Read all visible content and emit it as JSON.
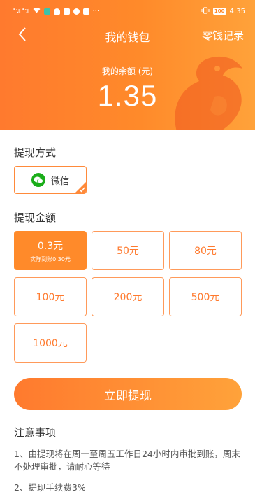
{
  "status_bar": {
    "signal_left": "⁴ᴳ.ıl ⁴ᴳ.ıl",
    "battery": "100",
    "time": "4:35"
  },
  "header": {
    "title": "我的钱包",
    "right_link": "零钱记录",
    "balance_label": "我的余额 (元)",
    "balance_value": "1.35"
  },
  "withdraw_method": {
    "title": "提现方式",
    "option": {
      "label": "微信",
      "icon": "wechat-icon",
      "selected": true
    }
  },
  "withdraw_amount": {
    "title": "提现金额",
    "options": [
      {
        "label": "0.3元",
        "sub": "实际到账0.30元",
        "selected": true
      },
      {
        "label": "50元"
      },
      {
        "label": "80元"
      },
      {
        "label": "100元"
      },
      {
        "label": "200元"
      },
      {
        "label": "500元"
      },
      {
        "label": "1000元"
      }
    ]
  },
  "action": {
    "submit_label": "立即提现"
  },
  "notes": {
    "title": "注意事项",
    "items": [
      "1、由提现将在周一至周五工作日24小时内审批到账，周末不处理审批，请耐心等待",
      "2、提现手续费3%"
    ]
  },
  "colors": {
    "accent": "#ff8a2a",
    "wechat": "#1aad19"
  }
}
